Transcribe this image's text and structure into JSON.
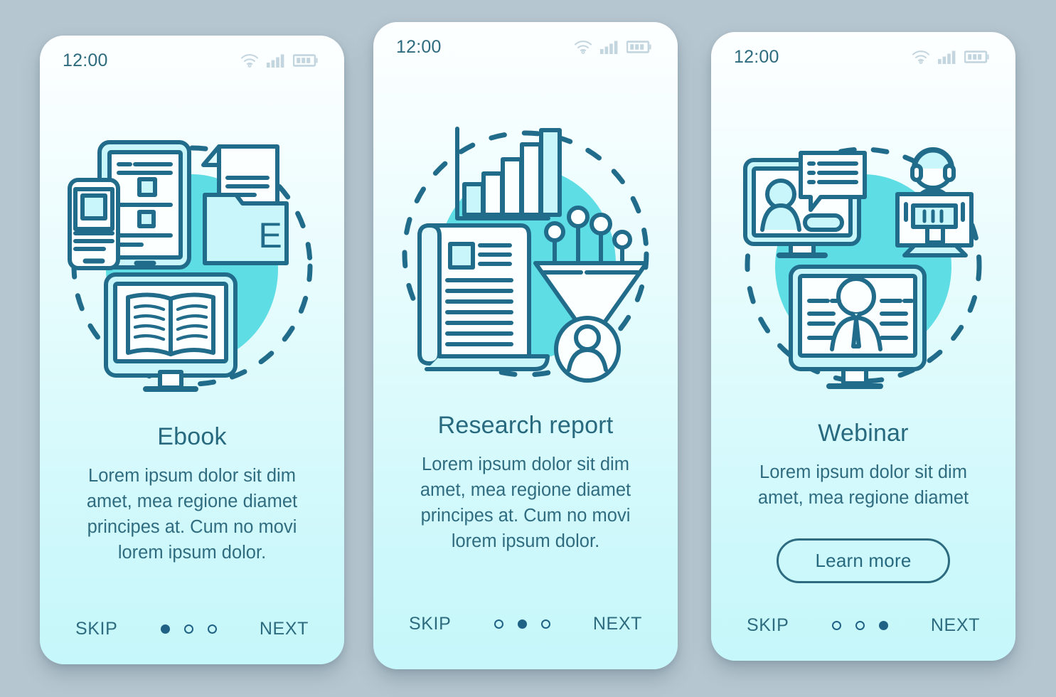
{
  "theme": {
    "page_background": "#b6c6d0",
    "card_top": "#fdffff",
    "card_bottom": "#c6f7fa",
    "accent_teal": "#5fdde5",
    "outline_dark": "#226c8b",
    "text_dark": "#27697f",
    "fill_light": "#c9f6fa",
    "status_icon": "#c3d5df"
  },
  "screens": [
    {
      "id": "ebook",
      "status_bar": {
        "time": "12:00",
        "icons": [
          "wifi-icon",
          "signal-icon",
          "battery-icon"
        ]
      },
      "illustration": "ebook-illustration",
      "illustration_parts": [
        "tablet-icon",
        "smartphone-icon",
        "document-page-icon",
        "folder-e-icon",
        "monitor-open-book-icon",
        "dashed-circle"
      ],
      "folder_label": "E",
      "title": "Ebook",
      "description": "Lorem ipsum dolor sit dim amet, mea regione diamet principes at. Cum no movi lorem ipsum dolor.",
      "cta": null,
      "nav": {
        "skip_label": "SKIP",
        "next_label": "NEXT",
        "dot_count": 3,
        "active_dot": 1
      }
    },
    {
      "id": "research-report",
      "status_bar": {
        "time": "12:00",
        "icons": [
          "wifi-icon",
          "signal-icon",
          "battery-icon"
        ]
      },
      "illustration": "research-report-illustration",
      "illustration_parts": [
        "bar-chart-icon",
        "scroll-document-icon",
        "funnel-icon",
        "node-pins-icon",
        "user-avatar-icon",
        "dashed-circle"
      ],
      "title": "Research report",
      "description": "Lorem ipsum dolor sit dim amet, mea regione diamet principes at. Cum no movi lorem ipsum dolor.",
      "cta": null,
      "nav": {
        "skip_label": "SKIP",
        "next_label": "NEXT",
        "dot_count": 3,
        "active_dot": 2
      }
    },
    {
      "id": "webinar",
      "status_bar": {
        "time": "12:00",
        "icons": [
          "wifi-icon",
          "signal-icon",
          "battery-icon"
        ]
      },
      "illustration": "webinar-illustration",
      "illustration_parts": [
        "monitor-video-call-icon",
        "chat-bubble-icon",
        "headset-operator-icon",
        "desktop-computer-icon",
        "monitor-presenter-icon",
        "dashed-circle"
      ],
      "title": "Webinar",
      "description": "Lorem ipsum dolor sit dim amet, mea regione diamet",
      "cta": "Learn more",
      "nav": {
        "skip_label": "SKIP",
        "next_label": "NEXT",
        "dot_count": 3,
        "active_dot": 3
      }
    }
  ]
}
